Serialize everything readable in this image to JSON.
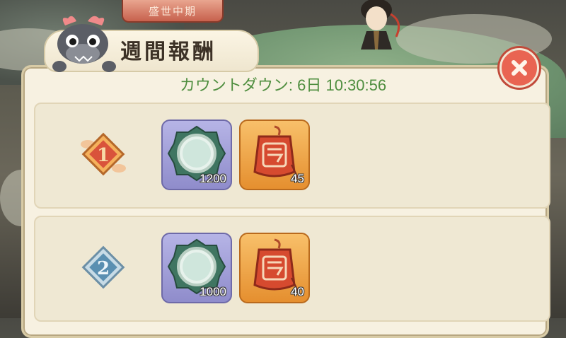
{
  "header": {
    "banner_text": "盛世中期",
    "title": "週間報酬",
    "countdown": "カウントダウン: 6日 10:30:56"
  },
  "rewards": [
    {
      "rank": "1",
      "items": [
        {
          "icon": "mirror-icon",
          "qty": "1200"
        },
        {
          "icon": "talisman-tag-icon",
          "qty": "45"
        }
      ]
    },
    {
      "rank": "2",
      "items": [
        {
          "icon": "mirror-icon",
          "qty": "1000"
        },
        {
          "icon": "talisman-tag-icon",
          "qty": "40"
        }
      ]
    }
  ],
  "colors": {
    "countdown_text": "#4f8e3f",
    "close_button": "#e96452",
    "panel_bg": "#f7f1e1",
    "rank1_badge": "#d9533b",
    "rank2_badge": "#5a8fb1"
  }
}
